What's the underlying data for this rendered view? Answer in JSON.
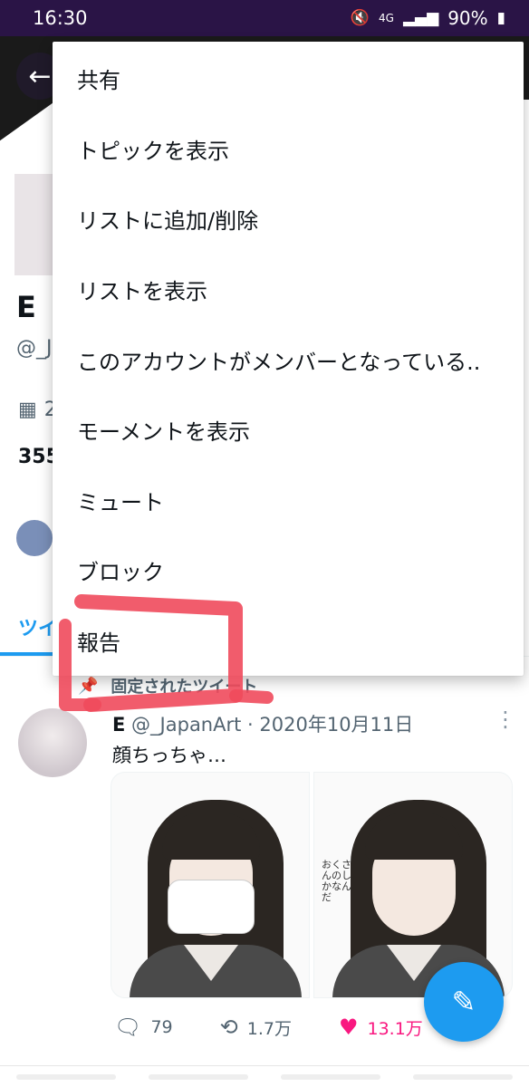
{
  "status_bar": {
    "time": "16:30",
    "battery": "90%",
    "network": "4G"
  },
  "profile": {
    "name": "E",
    "handle": "@_J",
    "joined": "2",
    "follow_count": "355"
  },
  "tabs": {
    "tweets_label": "ツイ"
  },
  "pinned": {
    "label": "固定されたツイート"
  },
  "tweet": {
    "author": "E",
    "handle": "@_JapanArt",
    "separator": " · ",
    "date": "2020年10月11日",
    "text": "顔ちっちゃ…",
    "note_text": "おくさんのしかなんだ",
    "replies": "79",
    "retweets": "1.7万",
    "likes": "13.1万"
  },
  "menu": {
    "items": [
      "共有",
      "トピックを表示",
      "リストに追加/削除",
      "リストを表示",
      "このアカウントがメンバーとなっている..",
      "モーメントを表示",
      "ミュート",
      "ブロック",
      "報告"
    ]
  },
  "colors": {
    "status_bar": "#2a1446",
    "accent": "#1d9bf0",
    "like": "#f91880",
    "annotation": "#f04a5c"
  },
  "icons": {
    "back": "arrow-left-icon",
    "compose": "feather-plus-icon",
    "reply": "reply-icon",
    "retweet": "retweet-icon",
    "like": "heart-icon",
    "more": "more-vertical-icon",
    "pin": "pin-icon",
    "calendar": "calendar-icon"
  }
}
